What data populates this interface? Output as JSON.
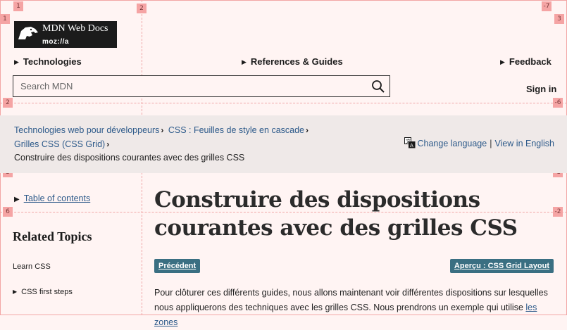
{
  "header": {
    "logo": {
      "title": "MDN Web Docs",
      "subtitle": "moz://a"
    },
    "nav": [
      "Technologies",
      "References & Guides",
      "Feedback"
    ],
    "search_placeholder": "Search MDN",
    "sign_in": "Sign in"
  },
  "breadcrumb": {
    "items": [
      "Technologies web pour développeurs",
      "CSS : Feuilles de style en cascade",
      "Grilles CSS (CSS Grid)"
    ],
    "current": "Construire des dispositions courantes avec des grilles CSS"
  },
  "language": {
    "change": "Change language",
    "separator": "|",
    "english": "View in English"
  },
  "sidebar": {
    "toc": "Table of contents",
    "related_title": "Related Topics",
    "learn": "Learn CSS",
    "first_steps": "CSS first steps"
  },
  "main": {
    "title": "Construire des dispositions courantes avec des grilles CSS",
    "prev": "Précédent",
    "next": "Aperçu : CSS Grid Layout",
    "para_text": "Pour clôturer ces différents guides, nous allons maintenant voir différentes dispositions sur lesquelles nous appliquerons des techniques avec les grilles CSS. Nous prendrons un exemple qui utilise ",
    "para_link": "les zones"
  },
  "overlay_labels": {
    "top_left": "1",
    "left_top": "1",
    "top_mid": "2",
    "top_right": "-7",
    "right_top": "3",
    "left2": "2",
    "right2": "-6",
    "left3": "3",
    "right3": "-5",
    "left6": "6",
    "right6": "-2"
  }
}
